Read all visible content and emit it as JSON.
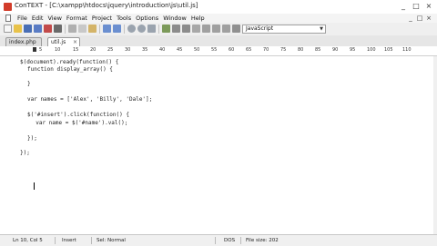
{
  "window": {
    "title": "ConTEXT - [C:\\xampp\\htdocs\\jquery\\introduction\\js\\util.js]",
    "controls": [
      "_",
      "□",
      "×"
    ]
  },
  "menubar": {
    "items": [
      "File",
      "Edit",
      "View",
      "Format",
      "Project",
      "Tools",
      "Options",
      "Window",
      "Help"
    ],
    "doc_controls": [
      "_",
      "□",
      "×"
    ]
  },
  "toolbar": {
    "language": "JavaScript"
  },
  "tabs": [
    {
      "label": "index.php",
      "active": false
    },
    {
      "label": "util.js",
      "active": true
    }
  ],
  "ruler": {
    "labels": [
      "5",
      "10",
      "15",
      "20",
      "25",
      "30",
      "35",
      "40",
      "45",
      "50",
      "55",
      "60",
      "65",
      "70",
      "75",
      "80",
      "85",
      "90",
      "95",
      "100",
      "105",
      "110"
    ]
  },
  "editor": {
    "lines": [
      "$(document).ready(function() {",
      "function display_array() {",
      "",
      "}",
      "",
      "var names = ['Alex', 'Billy', 'Dale'];",
      "",
      "$('#insert').click(function() {",
      "  var name = $('#name').val();",
      "",
      "});",
      "",
      "",
      "",
      "});"
    ]
  },
  "status": {
    "position": "Ln 10, Col 5",
    "mode": "Insert",
    "selection": "Sel: Normal",
    "format": "DOS",
    "filesize": "File size: 202"
  },
  "colors": {
    "code": "#222222",
    "toolbar_bg": "#efefef",
    "tab_active": "#ffffff",
    "app_icon": "#d23c2a"
  }
}
